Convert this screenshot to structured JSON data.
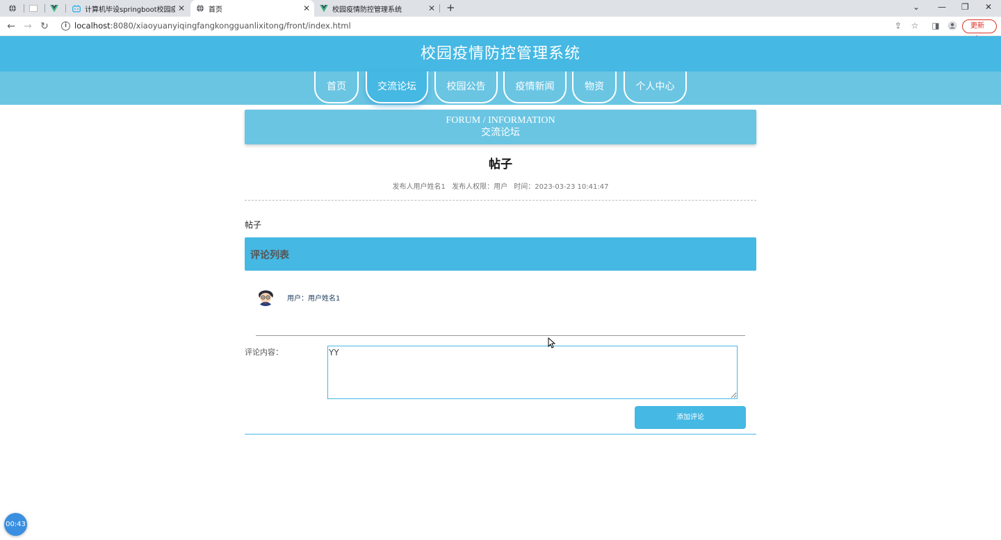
{
  "browser": {
    "tabs": [
      {
        "title": "",
        "icon": "globe-icon"
      },
      {
        "title": "",
        "icon": "blank-page-icon"
      },
      {
        "title": "",
        "icon": "vue-logo-icon"
      },
      {
        "title": "计算机毕设springboot校园疫情",
        "icon": "bilibili-icon"
      },
      {
        "title": "首页",
        "icon": "globe-icon"
      },
      {
        "title": "校园疫情防控管理系统",
        "icon": "vue-logo-icon"
      }
    ],
    "url_host": "localhost",
    "url_rest": ":8080/xiaoyuanyiqingfangkongguanlixitong/front/index.html",
    "update_label": "更新"
  },
  "site": {
    "title": "校园疫情防控管理系统",
    "nav": [
      {
        "label": "首页",
        "active": false
      },
      {
        "label": "交流论坛",
        "active": true
      },
      {
        "label": "校园公告",
        "active": false
      },
      {
        "label": "疫情新闻",
        "active": false
      },
      {
        "label": "物资",
        "active": false
      },
      {
        "label": "个人中心",
        "active": false
      }
    ]
  },
  "banner": {
    "en": "FORUM / INFORMATION",
    "zh": "交流论坛"
  },
  "post": {
    "title": "帖子",
    "author": "发布人用户姓名1",
    "role": "发布人权限：用户",
    "time": "时间：2023-03-23 10:41:47",
    "body": "帖子"
  },
  "comments": {
    "header": "评论列表",
    "items": [
      {
        "user": "用户：用户姓名1"
      }
    ]
  },
  "form": {
    "label": "评论内容：",
    "value": "YY",
    "submit_label": "添加评论"
  },
  "timer": "00:43",
  "colors": {
    "primary": "#45b8e3",
    "nav_bg": "#6ac5e3"
  }
}
